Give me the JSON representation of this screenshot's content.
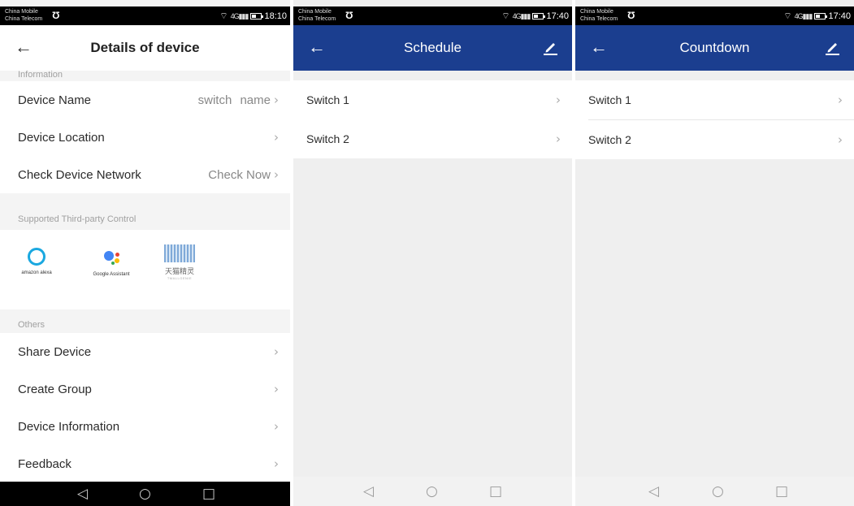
{
  "status_bars": [
    {
      "carrier1": "China Mobile",
      "carrier2": "China Telecom",
      "signal": "4G",
      "time": "18:10"
    },
    {
      "carrier1": "China Mobile",
      "carrier2": "China Telecom",
      "signal": "4G",
      "time": "17:40"
    },
    {
      "carrier1": "China Mobile",
      "carrier2": "China Telecom",
      "signal": "4G",
      "time": "17:40"
    }
  ],
  "details": {
    "title": "Details of device",
    "sections": {
      "information": "Information",
      "third_party": "Supported Third-party Control",
      "others": "Others"
    },
    "rows": {
      "device_name": {
        "label": "Device Name",
        "value": "switch name"
      },
      "device_location": {
        "label": "Device Location"
      },
      "check_network": {
        "label": "Check Device Network",
        "value": "Check Now"
      },
      "share_device": {
        "label": "Share Device"
      },
      "create_group": {
        "label": "Create Group"
      },
      "device_information": {
        "label": "Device Information"
      },
      "feedback": {
        "label": "Feedback"
      }
    },
    "third_party": {
      "alexa": "amazon alexa",
      "google": "Google Assistant",
      "tmall_name": "天猫精灵",
      "tmall_sub": "TMALLGENIE"
    }
  },
  "schedule": {
    "title": "Schedule",
    "items": [
      "Switch 1",
      "Switch 2"
    ]
  },
  "countdown": {
    "title": "Countdown",
    "items": [
      "Switch 1",
      "Switch 2"
    ]
  },
  "icons": {
    "back": "arrow-left-icon",
    "edit": "pencil-icon",
    "chevron": "chevron-right-icon",
    "nav_back": "triangle-back-icon",
    "nav_home": "circle-home-icon",
    "nav_recent": "square-recent-icon"
  },
  "colors": {
    "header_blue": "#1b3e8f",
    "alexa_blue": "#1aa8e0",
    "background": "#efefef"
  }
}
